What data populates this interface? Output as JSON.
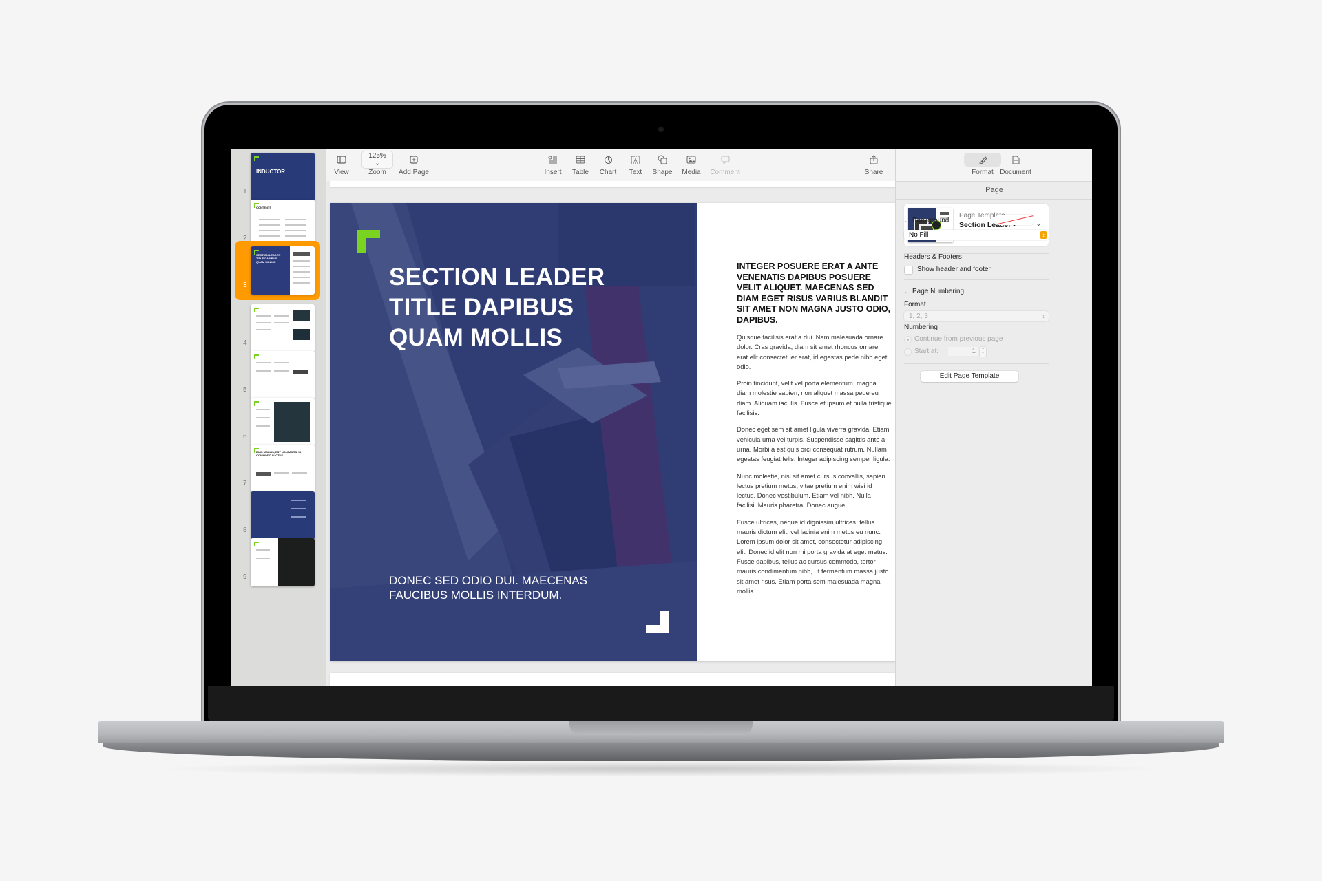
{
  "app": {
    "toolbar": {
      "view": {
        "label": "View",
        "icon": "sidebar-icon"
      },
      "zoom": {
        "label": "Zoom",
        "value": "125%",
        "icon": "chevron-down-icon"
      },
      "add_page": {
        "label": "Add Page",
        "icon": "plus-square-icon"
      },
      "insert": {
        "label": "Insert",
        "icon": "insert-icon"
      },
      "table": {
        "label": "Table",
        "icon": "table-icon"
      },
      "chart": {
        "label": "Chart",
        "icon": "chart-icon"
      },
      "text": {
        "label": "Text",
        "icon": "text-box-icon"
      },
      "shape": {
        "label": "Shape",
        "icon": "shape-icon"
      },
      "media": {
        "label": "Media",
        "icon": "media-icon"
      },
      "comment": {
        "label": "Comment",
        "icon": "comment-icon"
      },
      "share": {
        "label": "Share",
        "icon": "share-icon"
      },
      "format": {
        "label": "Format",
        "icon": "paintbrush-icon"
      },
      "document": {
        "label": "Document",
        "icon": "document-icon"
      }
    },
    "thumbnails": [
      {
        "number": "1",
        "title": "INDUCTOR",
        "style": "navy"
      },
      {
        "number": "2",
        "title": "CONTENTS",
        "style": "white"
      },
      {
        "number": "3",
        "title": "SECTION LEADER TITLE DAPIBUS QUAM MOLLIS",
        "style": "split",
        "selected": true
      },
      {
        "number": "4",
        "style": "white"
      },
      {
        "number": "5",
        "style": "white"
      },
      {
        "number": "6",
        "style": "white"
      },
      {
        "number": "7",
        "title": "DUIS MOLLIS, EST NON MORBI ID COMMODO LUCTUS",
        "style": "white"
      },
      {
        "number": "8",
        "style": "navy"
      },
      {
        "number": "9",
        "style": "white"
      }
    ],
    "page": {
      "title": "SECTION LEADER TITLE DAPIBUS QUAM MOLLIS",
      "title_lines": [
        "SECTION LEADER",
        "TITLE DAPIBUS",
        "QUAM MOLLIS"
      ],
      "subtitle_lines": [
        "DONEC SED ODIO DUI. MAECENAS",
        "FAUCIBUS MOLLIS INTERDUM."
      ],
      "lead": "INTEGER POSUERE ERAT A ANTE VENENATIS DAPIBUS POSUERE VELIT ALIQUET. MAECENAS SED DIAM EGET RISUS VARIUS BLANDIT SIT AMET NON MAGNA JUSTO ODIO, DAPIBUS.",
      "paragraphs": [
        "Quisque facilisis erat a dui. Nam malesuada ornare dolor. Cras gravida, diam sit amet rhoncus ornare, erat elit consectetuer erat, id egestas pede nibh eget odio.",
        "Proin tincidunt, velit vel porta elementum, magna diam molestie sapien, non aliquet massa pede eu diam. Aliquam iaculis. Fusce et ipsum et nulla tristique facilisis.",
        "Donec eget sem sit amet ligula viverra gravida. Etiam vehicula urna vel turpis. Suspendisse sagittis ante a urna. Morbi a est quis orci consequat rutrum. Nullam egestas feugiat felis. Integer adipiscing semper ligula.",
        "Nunc molestie, nisl sit amet cursus convallis, sapien lectus pretium metus, vitae pretium enim wisi id lectus. Donec vestibulum. Etiam vel nibh. Nulla facilisi. Mauris pharetra. Donec augue.",
        "Fusce ultrices, neque id dignissim ultrices, tellus mauris dictum elit, vel lacinia enim metus eu nunc. Lorem ipsum dolor sit amet, consectetur adipiscing elit. Donec id elit non mi porta gravida at eget metus. Fusce dapibus, tellus ac cursus commodo, tortor mauris condimentum nibh, ut fermentum massa justo sit amet risus. Etiam porta sem malesuada magna mollis"
      ],
      "colors": {
        "navy": "#2b3b7b",
        "accent_green": "#7bd321"
      }
    },
    "inspector": {
      "header": "Page",
      "template_label": "Page Template",
      "template_name": "Section Leader - Layered Wide",
      "background_label": "Background",
      "fill_value": "No Fill",
      "headers_footers_label": "Headers & Footers",
      "show_header_footer": "Show header and footer",
      "show_header_footer_checked": false,
      "page_numbering_label": "Page Numbering",
      "format_label": "Format",
      "format_value": "1, 2, 3",
      "numbering_label": "Numbering",
      "continue_option": "Continue from previous page",
      "start_at_option": "Start at:",
      "start_at_value": "1",
      "edit_template_button": "Edit Page Template",
      "accent_color": "#f5a300"
    }
  }
}
